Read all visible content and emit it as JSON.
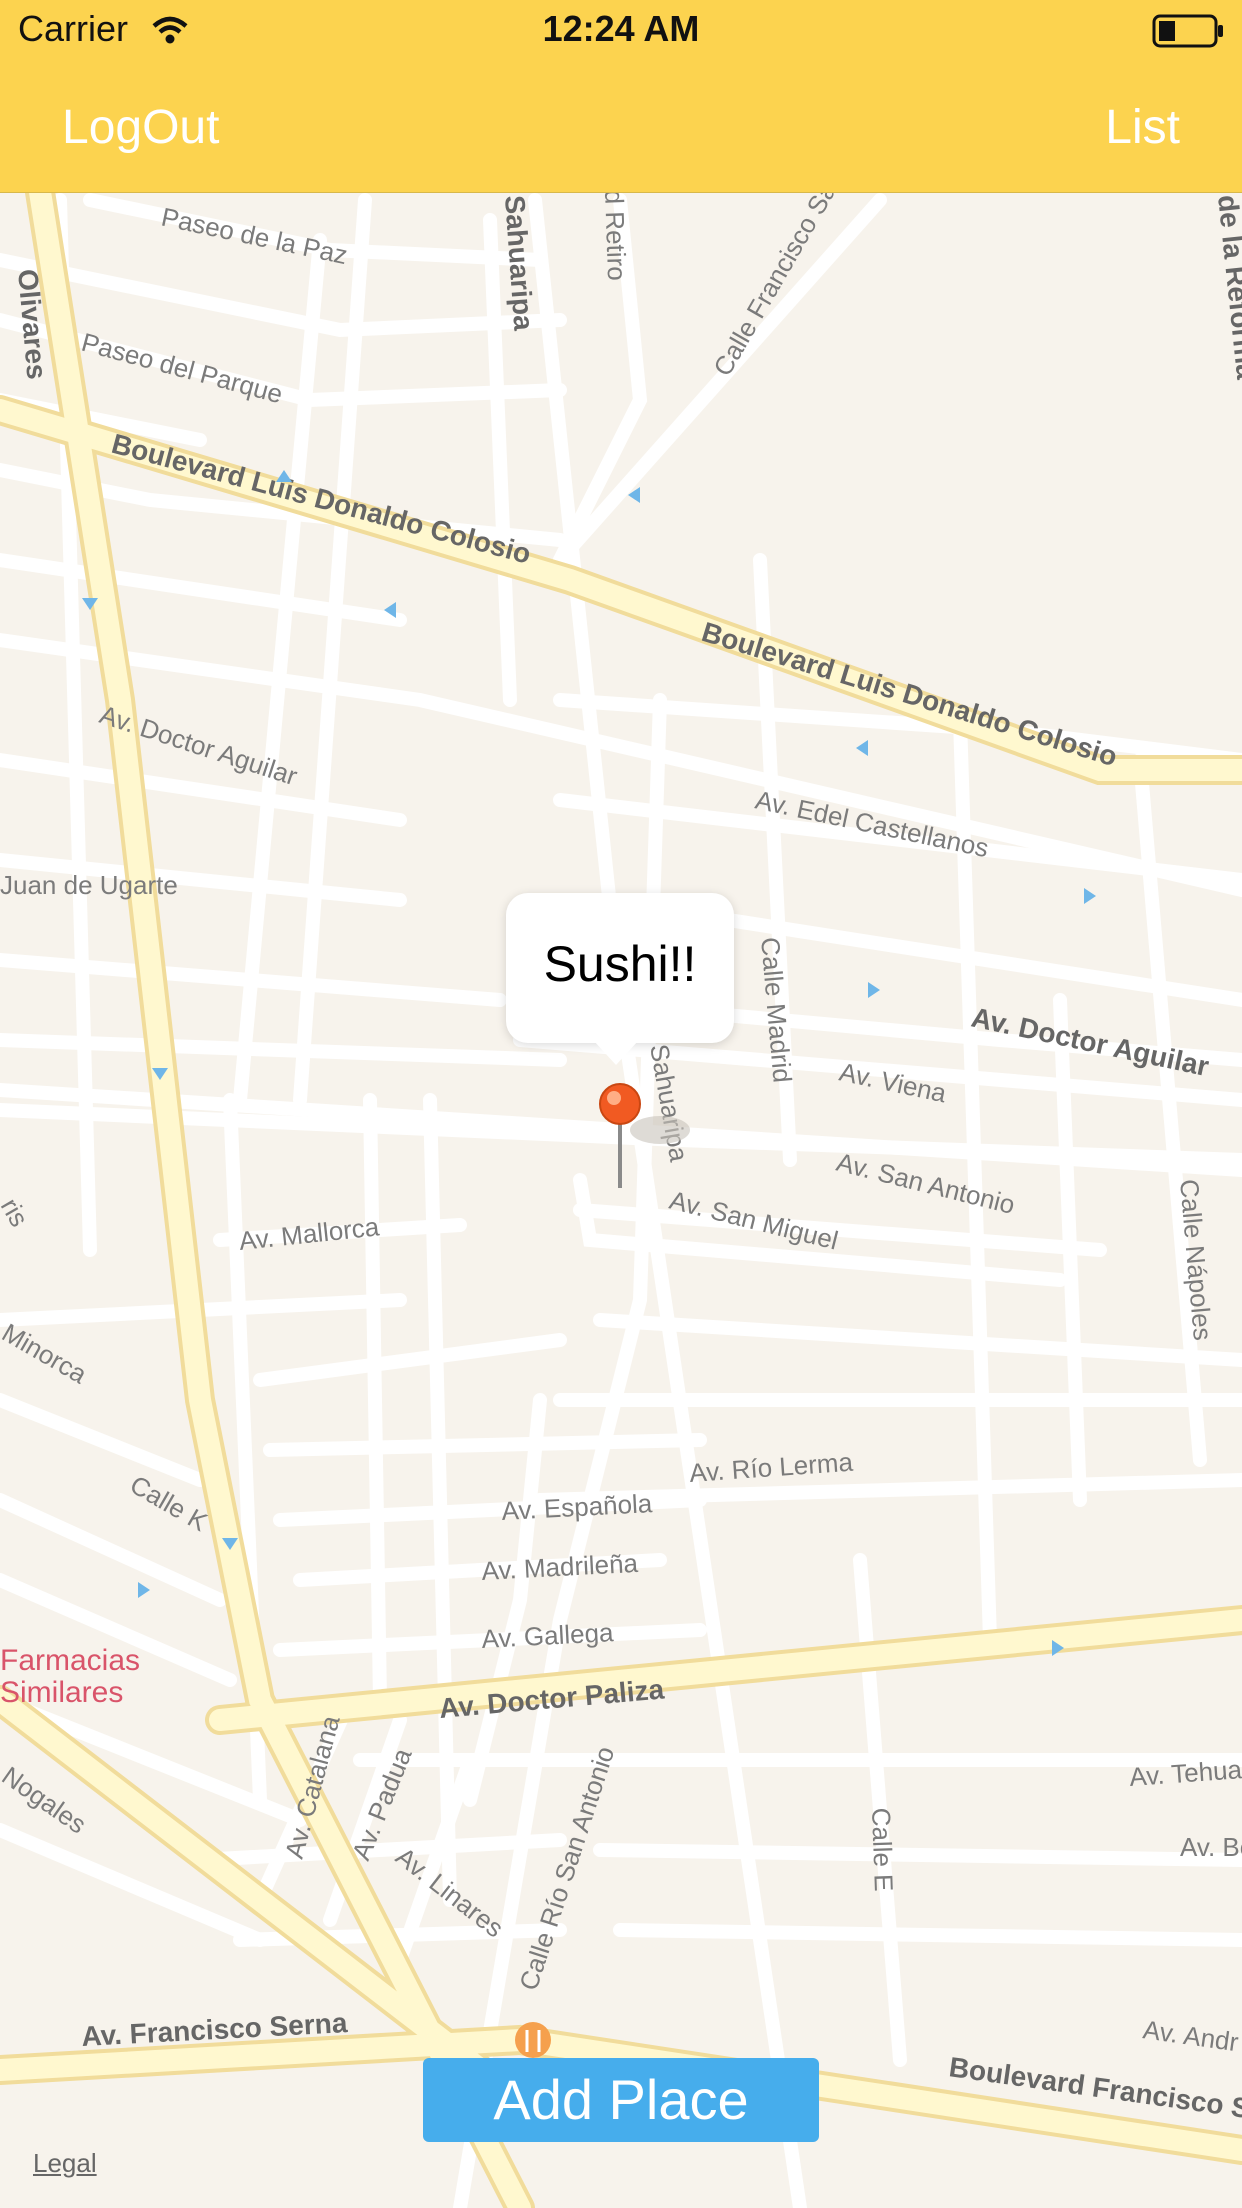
{
  "status_bar": {
    "carrier": "Carrier",
    "time": "12:24 AM"
  },
  "nav": {
    "left_label": "LogOut",
    "right_label": "List"
  },
  "map": {
    "annotation_title": "Sushi!!",
    "legal_label": "Legal",
    "poi_label_line1": "Farmacias",
    "poi_label_line2": "Similares",
    "streets": {
      "olivares": "Olivares",
      "paseo_paz": "Paseo de la Paz",
      "paseo_parque": "Paseo del Parque",
      "sahuaripa_top": "Sahuaripa",
      "retiro": "d Retiro",
      "francisco_salaz": "Calle Francisco Salaz",
      "reforma": "de la Reforma",
      "colosio_1": "Boulevard Luis Donaldo Colosio",
      "colosio_2": "Boulevard Luis Donaldo Colosio",
      "doctor_aguilar_1": "Av. Doctor Aguilar",
      "doctor_aguilar_2": "Av. Doctor Aguilar",
      "edel": "Av. Edel Castellanos",
      "juan_ugarte": "Juan de Ugarte",
      "madrid": "Calle Madrid",
      "viena": "Av. Viena",
      "sahuaripa_mid": "Sahuaripa",
      "san_antonio": "Av. San Antonio",
      "san_miguel": "Av. San Miguel",
      "mallorca": "Av. Mallorca",
      "napoles": "Calle Nápoles",
      "iris": "ris",
      "minorca": "Minorca",
      "calle_k": "Calle K",
      "rio_lerma": "Av. Río Lerma",
      "espanola": "Av. Española",
      "madrilena": "Av. Madrileña",
      "gallega": "Av. Gallega",
      "doctor_paliza": "Av. Doctor Paliza",
      "catalana": "Av. Catalana",
      "padua": "Av. Padua",
      "linares": "Av. Linares",
      "rio_san_antonio": "Calle Río San Antonio",
      "calle_e": "Calle E",
      "tehuan": "Av. Tehuan",
      "av_be": "Av. Be",
      "av_andr": "Av. Andr",
      "nogales": "Nogales",
      "francisco_serna": "Av. Francisco Serna",
      "blvd_francisco_serna": "Boulevard Francisco Ser"
    }
  },
  "actions": {
    "add_place_label": "Add Place"
  },
  "colors": {
    "bar": "#fcd34f",
    "button": "#46adec",
    "map_bg": "#f7f3ec",
    "major_road": "#fff3c2",
    "pin": "#f15a22"
  },
  "icons": {
    "wifi": "wifi-icon",
    "battery": "battery-icon",
    "pin": "map-pin-icon",
    "restaurant": "restaurant-icon"
  }
}
